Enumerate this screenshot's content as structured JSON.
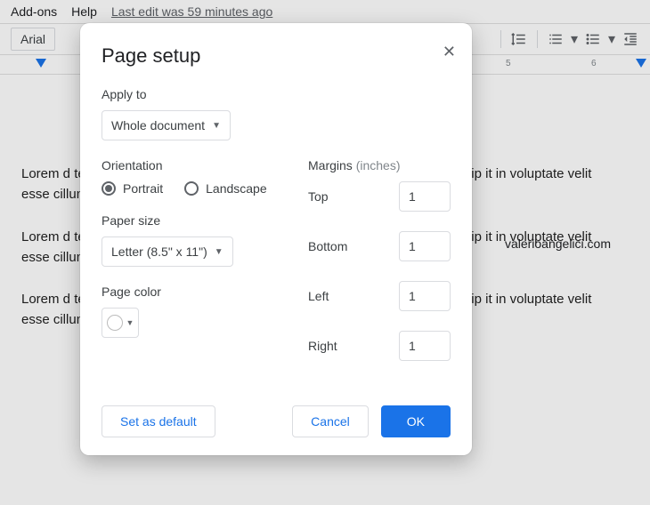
{
  "menubar": {
    "addons": "Add-ons",
    "help": "Help",
    "last_edit": "Last edit was 59 minutes ago"
  },
  "toolbar": {
    "font_name": "Arial"
  },
  "ruler": {
    "n5": "5",
    "n6": "6"
  },
  "page": {
    "url": "valerioangelici.com",
    "para1": "Lorem                                                                                               d tempor incididunt ut labore et dolo                                                                                             ation ullamco laboris nisi ut aliquip                                                                                              it in voluptate velit esse cillum                                                                                                 non proident, sunt in culpa qui off",
    "para2": "Lorem                                                                                               d tempor incididunt ut labore et dolo                                                                                             ation ullamco laboris nisi ut aliquip                                                                                              it in voluptate velit esse cillum                                                                                                 non proident, sunt in culpa qui off",
    "para3": "Lorem                                                                                               d tempor incididunt ut labore et dolo                                                                                             ation ullamco laboris nisi ut aliquip                                                                                              it in voluptate velit esse cillum                                                                                                 non proident, sunt in culpa qui off"
  },
  "dialog": {
    "title": "Page setup",
    "apply_to_label": "Apply to",
    "apply_to_value": "Whole document",
    "orientation_label": "Orientation",
    "portrait": "Portrait",
    "landscape": "Landscape",
    "paper_size_label": "Paper size",
    "paper_size_value": "Letter (8.5\" x 11\")",
    "page_color_label": "Page color",
    "margins_label": "Margins",
    "margins_unit": "(inches)",
    "top_label": "Top",
    "bottom_label": "Bottom",
    "left_label": "Left",
    "right_label": "Right",
    "margin_top": "1",
    "margin_bottom": "1",
    "margin_left": "1",
    "margin_right": "1",
    "set_default": "Set as default",
    "cancel": "Cancel",
    "ok": "OK"
  }
}
